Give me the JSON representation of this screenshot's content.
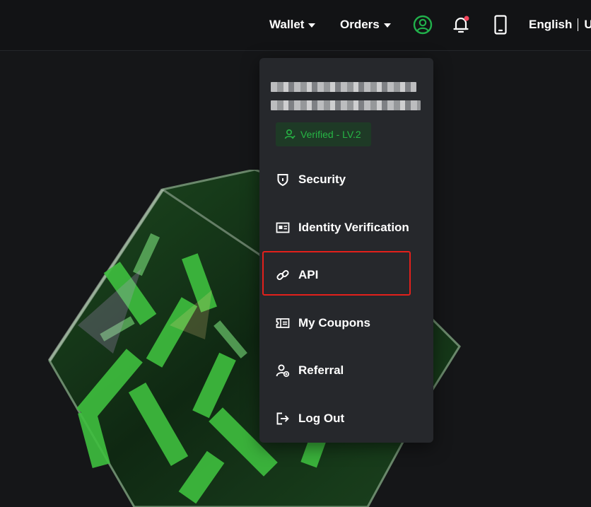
{
  "header": {
    "wallet_label": "Wallet",
    "orders_label": "Orders",
    "language_label": "English",
    "currency_partial": "U",
    "icons": [
      "user-circle-icon",
      "bell-icon",
      "mobile-phone-icon"
    ],
    "accent_color": "#21b04b",
    "notification_dot_color": "#f6465d"
  },
  "menu": {
    "verified_badge": "Verified - LV.2",
    "items": [
      {
        "label": "Security",
        "icon": "shield-icon"
      },
      {
        "label": "Identity Verification",
        "icon": "id-card-icon"
      },
      {
        "label": "API",
        "icon": "link-icon"
      },
      {
        "label": "My Coupons",
        "icon": "coupon-ticket-icon"
      },
      {
        "label": "Referral",
        "icon": "referral-user-icon"
      },
      {
        "label": "Log Out",
        "icon": "logout-icon"
      }
    ],
    "highlighted_item": "API",
    "highlight_color": "#e3201b"
  }
}
